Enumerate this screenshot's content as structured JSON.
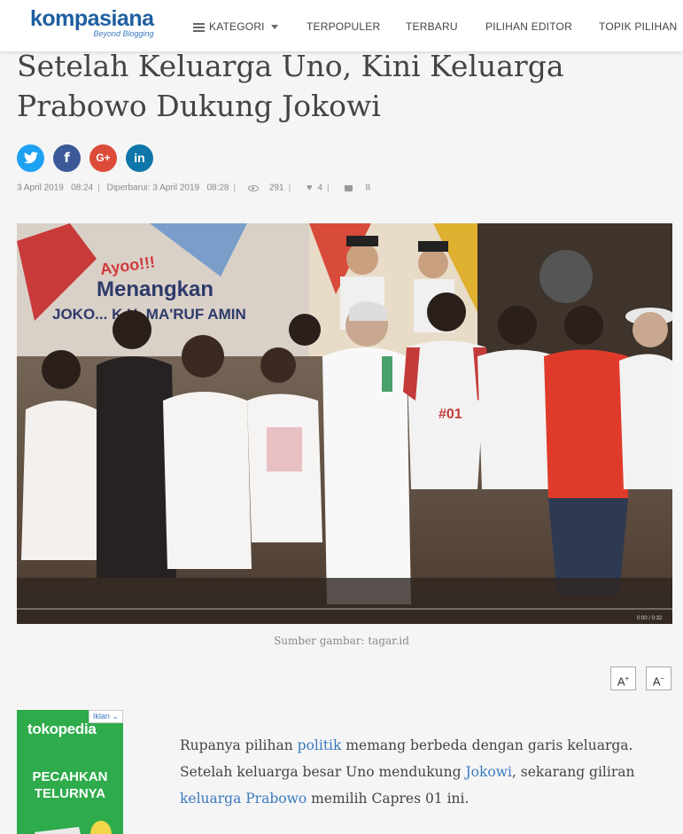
{
  "nav": {
    "logo": "kompasiana",
    "tagline": "Beyond Blogging",
    "items": [
      {
        "label": "KATEGORI"
      },
      {
        "label": "TERPOPULER"
      },
      {
        "label": "TERBARU"
      },
      {
        "label": "PILIHAN EDITOR"
      },
      {
        "label": "TOPIK PILIHAN"
      }
    ]
  },
  "article": {
    "title": "Setelah Keluarga Uno, Kini Keluarga Prabowo Dukung Jokowi",
    "share": {
      "twitter": "t",
      "facebook": "f",
      "google": "G+",
      "linkedin": "in"
    },
    "meta": {
      "date": "3 April 2019",
      "time": "08:24",
      "updated_label": "Diperbarui: 3 April 2019",
      "updated_time": "08:28",
      "views": "291",
      "likes": "4",
      "comments": "8"
    },
    "image_caption": "Sumber gambar: tagar.id",
    "banner_text_1": "Ayoo!!!",
    "banner_text_2": "Menangkan",
    "banner_text_3": "JOKO... K.H. MA'RUF AMIN",
    "shirt_text": "#01",
    "video_time": "0:00 / 0:32",
    "font_increase": "A",
    "font_decrease": "A",
    "paragraph": {
      "p1": "Rupanya pilihan ",
      "link1": "politik",
      "p2": " memang berbeda dengan garis keluarga. Setelah keluarga besar Uno mendukung ",
      "link2": "Jokowi",
      "p3": ", sekarang giliran ",
      "link3": "keluarga Prabowo",
      "p4": " memilih Capres 01 ini."
    }
  },
  "ad": {
    "label": "Iklan",
    "brand": "tokopedia",
    "headline_1": "PECAHKAN",
    "headline_2": "TELURNYA"
  },
  "colors": {
    "brand_blue": "#1f5fa1",
    "link": "#3a79bf",
    "twitter": "#1da1f2",
    "facebook": "#3b5998",
    "google": "#dd4b39",
    "linkedin": "#0e76a8",
    "ad_green": "#2eab4b"
  }
}
